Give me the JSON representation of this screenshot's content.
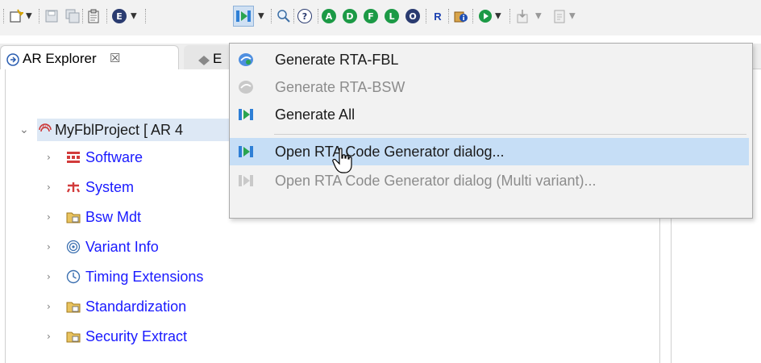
{
  "toolbar": {
    "buttons": [
      {
        "name": "new-icon"
      },
      {
        "name": "save-icon"
      },
      {
        "name": "save-all-icon"
      },
      {
        "name": "clipboard-icon"
      },
      {
        "name": "e-circle-icon",
        "letter": "E"
      },
      {
        "name": "generate-rta-icon"
      },
      {
        "name": "search-icon"
      },
      {
        "name": "help-icon",
        "letter": "?"
      },
      {
        "name": "a-circle-icon",
        "letter": "A"
      },
      {
        "name": "d-circle-icon",
        "letter": "D"
      },
      {
        "name": "f-circle-icon",
        "letter": "F"
      },
      {
        "name": "l-circle-icon",
        "letter": "L"
      },
      {
        "name": "o-circle-icon",
        "letter": "O"
      },
      {
        "name": "report-icon",
        "letter": "R"
      },
      {
        "name": "info-icon",
        "letter": "i"
      },
      {
        "name": "run-icon"
      },
      {
        "name": "import-icon"
      },
      {
        "name": "export-icon"
      }
    ]
  },
  "tabs": {
    "active_label": "AR Explorer",
    "close_glyph": "☒",
    "inactive_label": "E"
  },
  "tree": {
    "root": {
      "label": "MyFblProject [ AR 4",
      "chevron": "⌄"
    },
    "items": [
      {
        "label": "Software",
        "icon": "software-icon"
      },
      {
        "label": "System",
        "icon": "system-icon"
      },
      {
        "label": "Bsw Mdt",
        "icon": "folder-icon"
      },
      {
        "label": "Variant Info",
        "icon": "variant-info-icon"
      },
      {
        "label": "Timing Extensions",
        "icon": "clock-icon"
      },
      {
        "label": "Standardization",
        "icon": "folder-icon"
      },
      {
        "label": "Security Extract",
        "icon": "folder-icon"
      }
    ],
    "chevron": "›"
  },
  "menu": {
    "items": [
      {
        "label": "Generate RTA-FBL",
        "enabled": true,
        "icon": "generate-fbl-icon"
      },
      {
        "label": "Generate RTA-BSW",
        "enabled": false,
        "icon": "generate-bsw-icon"
      },
      {
        "label": "Generate All",
        "enabled": true,
        "icon": "generate-all-icon"
      },
      {
        "label": "Open RTA Code Generator dialog...",
        "enabled": true,
        "highlighted": true,
        "icon": "code-generator-icon"
      },
      {
        "label": "Open RTA Code Generator dialog (Multi variant)...",
        "enabled": false,
        "icon": "code-generator-multi-icon"
      }
    ]
  },
  "colors": {
    "accent_green": "#1c9a46",
    "link_blue": "#1a1aff",
    "menu_highlight": "#c6def6",
    "selection": "#dde8f5"
  }
}
